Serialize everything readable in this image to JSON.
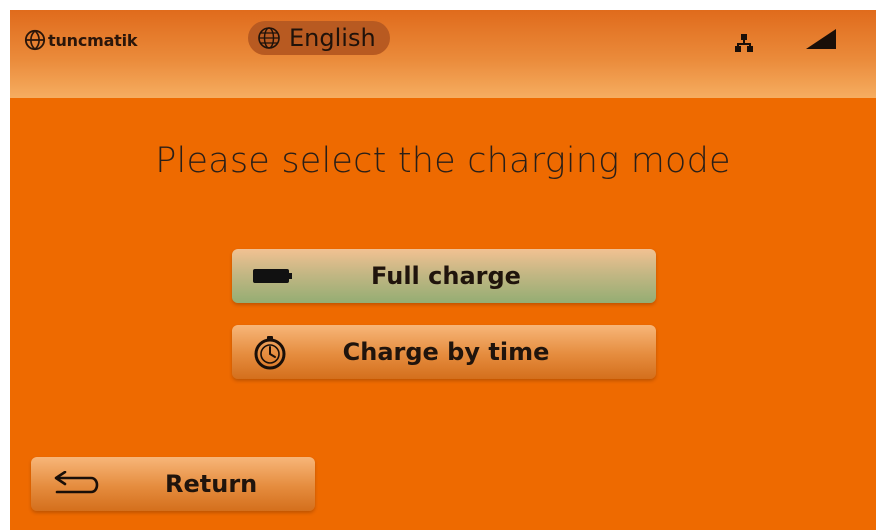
{
  "header": {
    "brand": "tuncmatik",
    "language": "English",
    "icons": [
      "globe-logo-icon",
      "globe-icon",
      "network-icon",
      "signal-icon"
    ]
  },
  "main": {
    "title": "Please select the charging mode",
    "options": [
      {
        "label": "Full charge",
        "icon": "battery-icon"
      },
      {
        "label": "Charge by time",
        "icon": "timer-icon"
      }
    ]
  },
  "footer": {
    "return_label": "Return",
    "return_icon": "return-arrow-icon"
  },
  "colors": {
    "background": "#ee6a00",
    "header_top": "#e06b1c",
    "header_bottom": "#f6ad60",
    "language_pill": "#b85a21",
    "full_charge_green": "#94ad73",
    "button_orange": "#e58c3e",
    "text_dark": "#20140c"
  }
}
